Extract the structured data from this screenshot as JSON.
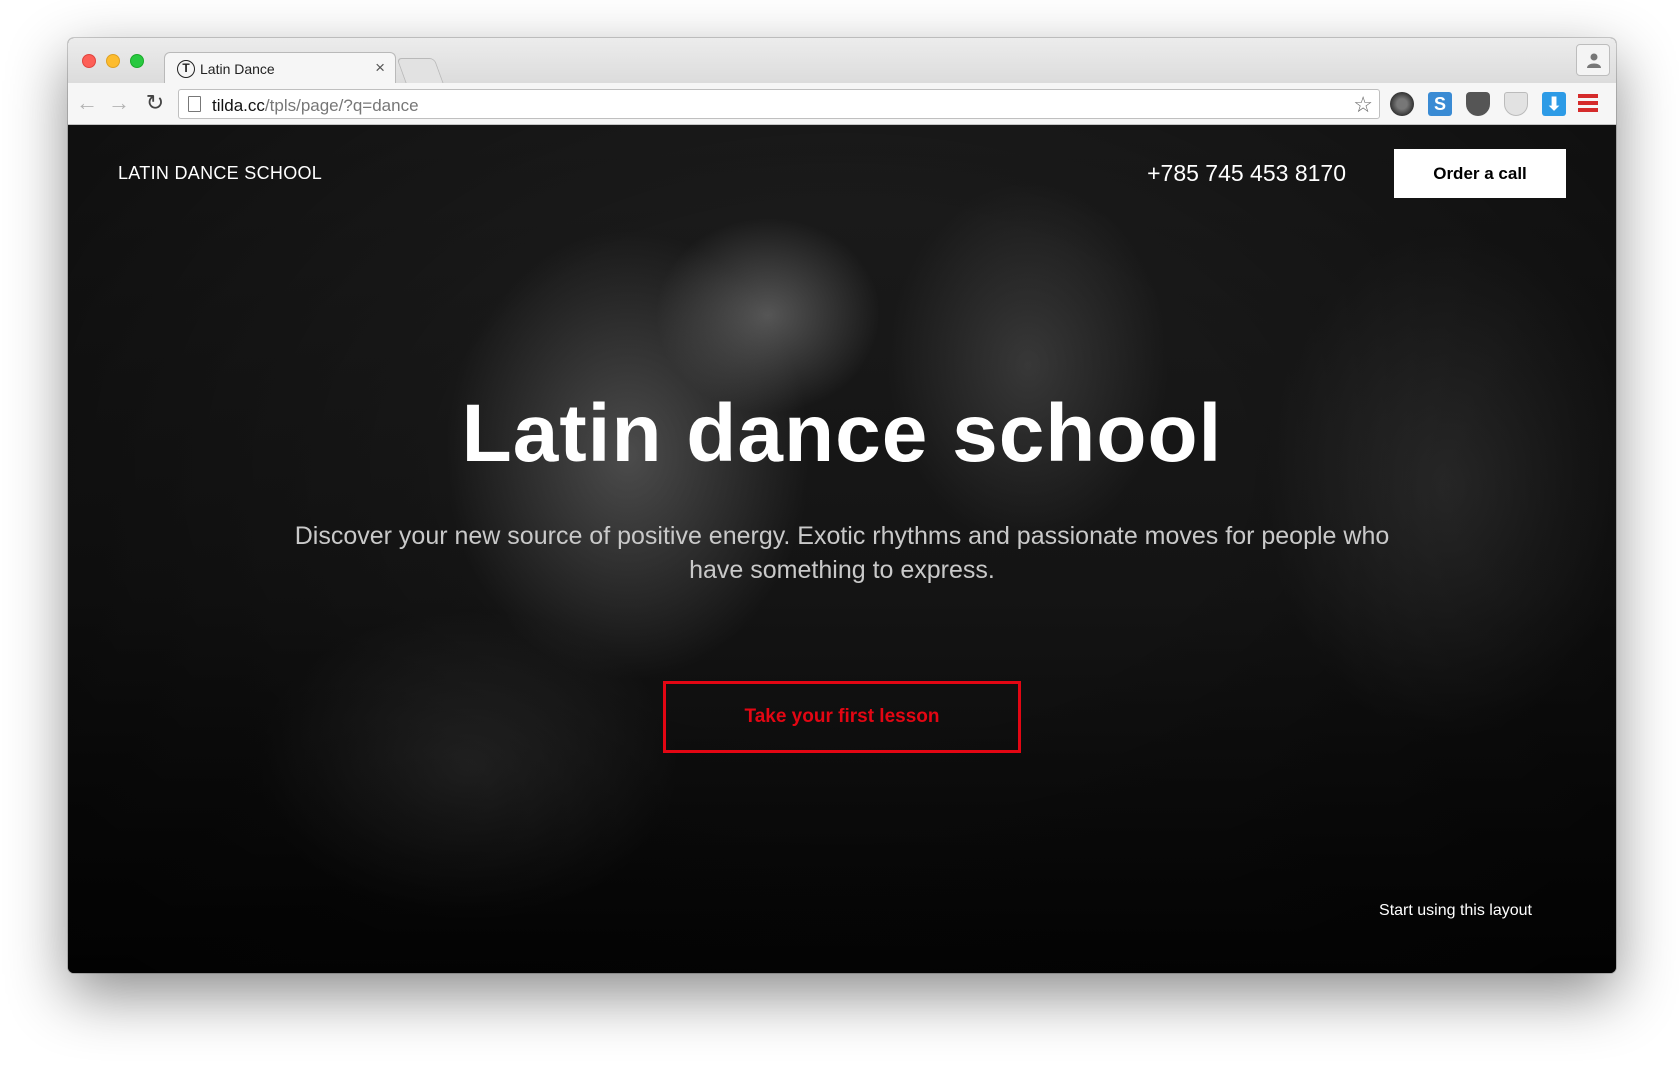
{
  "browser": {
    "tab": {
      "favicon": "T",
      "title": "Latin Dance",
      "close_glyph": "×"
    },
    "nav": {
      "back_glyph": "←",
      "forward_glyph": "→",
      "reload_glyph": "↻"
    },
    "address": {
      "host": "tilda.cc",
      "path": "/tpls/page/?q=dance"
    },
    "icons": {
      "bookmark": "star-icon",
      "extensions": [
        "film-icon",
        "s-extension-icon",
        "pocket-icon",
        "shield-icon",
        "download-icon",
        "menu-icon"
      ],
      "s_glyph": "S",
      "download_glyph": "⬇",
      "star_glyph": "☆"
    },
    "colors": {
      "menu_icon": "#d52b2b",
      "download_icon": "#2d9be6"
    }
  },
  "page": {
    "brand": "LATIN DANCE SCHOOL",
    "phone": "+785 745 453 8170",
    "order_button": "Order a call",
    "hero": {
      "title": "Latin dance school",
      "subtitle": "Discover your new source of positive energy. Exotic rhythms and passionate moves for people who have something to express."
    },
    "cta_button": "Take your first lesson",
    "start_link": "Start using this layout",
    "colors": {
      "accent": "#e30613",
      "background": "#141414",
      "text": "#ffffff"
    }
  }
}
